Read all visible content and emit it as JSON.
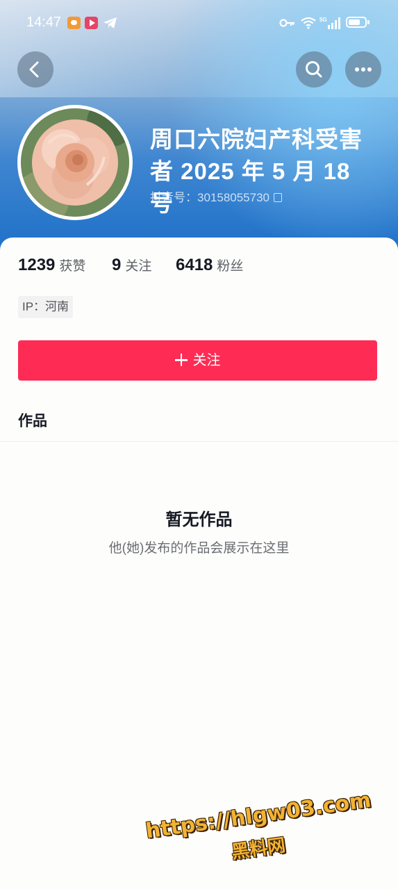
{
  "status_bar": {
    "time": "14:47",
    "network": "5G"
  },
  "profile": {
    "name": "周口六院妇产科受害者 2025 年 5 月 18 号",
    "douyin_id": "抖音号：30158055730"
  },
  "stats": [
    {
      "value": "1239",
      "label": "获赞"
    },
    {
      "value": "9",
      "label": "关注"
    },
    {
      "value": "6418",
      "label": "粉丝"
    }
  ],
  "ip_tag": "IP：河南",
  "follow_button": "关注",
  "tabs": {
    "works": "作品"
  },
  "empty_state": {
    "title": "暂无作品",
    "subtitle": "他(她)发布的作品会展示在这里"
  },
  "watermark": {
    "url": "https://hlgw03.com",
    "name": "黑料网"
  },
  "colors": {
    "follow_button": "#fe2c55",
    "header_blue": "#1d6fc8"
  }
}
